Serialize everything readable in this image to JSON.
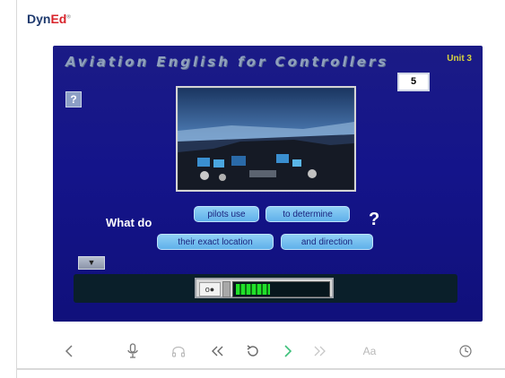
{
  "brand": {
    "name_dyn": "Dyn",
    "name_ed": "Ed",
    "mark": "®"
  },
  "lesson": {
    "title": "Aviation English for Controllers",
    "unit_label": "Unit 3",
    "page_number": "5",
    "help_label": "?"
  },
  "sentence": {
    "lead": "What do",
    "chips": [
      "pilots use",
      "to determine",
      "their exact location",
      "and direction"
    ],
    "question_mark": "?"
  },
  "controls": {
    "down_arrow_label": "▼",
    "mic_label": "o●",
    "voice_level": 0.38
  },
  "nav": {
    "aa_label": "Aa",
    "icons": [
      "back-icon",
      "microphone-icon",
      "headphones-icon",
      "rewind-icon",
      "repeat-icon",
      "next-icon",
      "fast-forward-icon",
      "text-size-icon",
      "clock-icon"
    ]
  },
  "colors": {
    "stage_bg": "#14148a",
    "chip_bg": "#6fbdee",
    "unit_label": "#d7d43e",
    "next_active": "#3cc07a",
    "inactive_icon": "#c8c8c8"
  }
}
